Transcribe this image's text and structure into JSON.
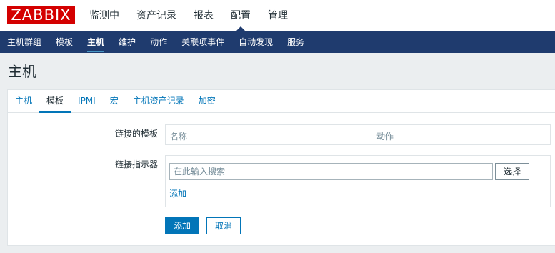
{
  "app": {
    "logo": "ZABBIX"
  },
  "main_menu": [
    {
      "label": "监测中",
      "active": false
    },
    {
      "label": "资产记录",
      "active": false
    },
    {
      "label": "报表",
      "active": false
    },
    {
      "label": "配置",
      "active": true
    },
    {
      "label": "管理",
      "active": false
    }
  ],
  "sub_menu": [
    {
      "label": "主机群组",
      "active": false
    },
    {
      "label": "模板",
      "active": false
    },
    {
      "label": "主机",
      "active": true
    },
    {
      "label": "维护",
      "active": false
    },
    {
      "label": "动作",
      "active": false
    },
    {
      "label": "关联项事件",
      "active": false
    },
    {
      "label": "自动发现",
      "active": false
    },
    {
      "label": "服务",
      "active": false
    }
  ],
  "page": {
    "title": "主机"
  },
  "tabs": [
    {
      "label": "主机",
      "active": false
    },
    {
      "label": "模板",
      "active": true
    },
    {
      "label": "IPMI",
      "active": false
    },
    {
      "label": "宏",
      "active": false
    },
    {
      "label": "主机资产记录",
      "active": false
    },
    {
      "label": "加密",
      "active": false
    }
  ],
  "form": {
    "linked_templates_label": "链接的模板",
    "linked_table": {
      "col_name": "名称",
      "col_action": "动作"
    },
    "link_indicator_label": "链接指示器",
    "search": {
      "placeholder": "在此输入搜索",
      "value": ""
    },
    "select_label": "选择",
    "add_link_label": "添加",
    "submit_label": "添加",
    "cancel_label": "取消"
  },
  "colors": {
    "brand": "#d40000",
    "nav_bg": "#1f3b6e",
    "link": "#0275b8"
  }
}
